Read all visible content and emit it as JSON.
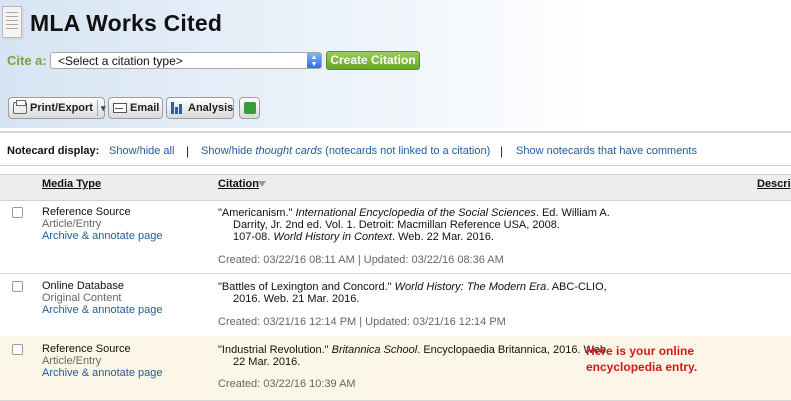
{
  "header": {
    "title": "MLA Works Cited",
    "cite_label": "Cite a:",
    "select_value": "<Select a citation type>",
    "create_button": "Create Citation"
  },
  "toolbar": {
    "print_export": "Print/Export",
    "email": "Email",
    "analysis": "Analysis"
  },
  "notecard_bar": {
    "label": "Notecard display:",
    "show_hide_all": "Show/hide all",
    "sep1": "|",
    "show_hide_prefix": "Show/hide",
    "thought_cards": "thought cards",
    "not_linked": "(notecards not linked to a citation)",
    "sep2": "|",
    "show_comments": "Show notecards that have comments"
  },
  "table": {
    "columns": {
      "media_type": "Media Type",
      "citation": "Citation",
      "description": "Descrip"
    },
    "rows": [
      {
        "type": "Reference Source",
        "subtype": "Article/Entry",
        "link": "Archive & annotate page",
        "citation": {
          "l1_a": "\"Americanism.\"",
          "l1_b": "International Encyclopedia of the Social Sciences",
          "l1_c": ". Ed. William A.",
          "l2": "Darrity, Jr. 2nd ed. Vol. 1. Detroit: Macmillan Reference USA, 2008.",
          "l3_a": "107-08.",
          "l3_b": "World History in Context",
          "l3_c": ". Web. 22 Mar. 2016."
        },
        "meta": "Created: 03/22/16 08:11 AM | Updated: 03/22/16 08:36 AM"
      },
      {
        "type": "Online Database",
        "subtype": "Original Content",
        "link": "Archive & annotate page",
        "citation": {
          "l1_a": "\"Battles of Lexington and Concord.\"",
          "l1_b": "World History: The Modern Era",
          "l1_c": ". ABC-CLIO,",
          "l2": "2016. Web. 21 Mar. 2016."
        },
        "meta": "Created: 03/21/16 12:14 PM | Updated: 03/21/16 12:14 PM"
      },
      {
        "type": "Reference Source",
        "subtype": "Article/Entry",
        "link": "Archive & annotate page",
        "citation": {
          "l1_a": "\"Industrial Revolution.\"",
          "l1_b": "Britannica School",
          "l1_c": ". Encyclopaedia Britannica, 2016. Web.",
          "l2": "22 Mar. 2016."
        },
        "meta": "Created: 03/22/16 10:39 AM",
        "annotation": [
          "Here is your online",
          "encyclopedia entry."
        ]
      }
    ]
  },
  "colors": {
    "accent_green": "#7aa43a",
    "link_blue": "#1f5c99",
    "annotation_red": "#d4171b",
    "highlight_row": "#fbf6e7"
  }
}
